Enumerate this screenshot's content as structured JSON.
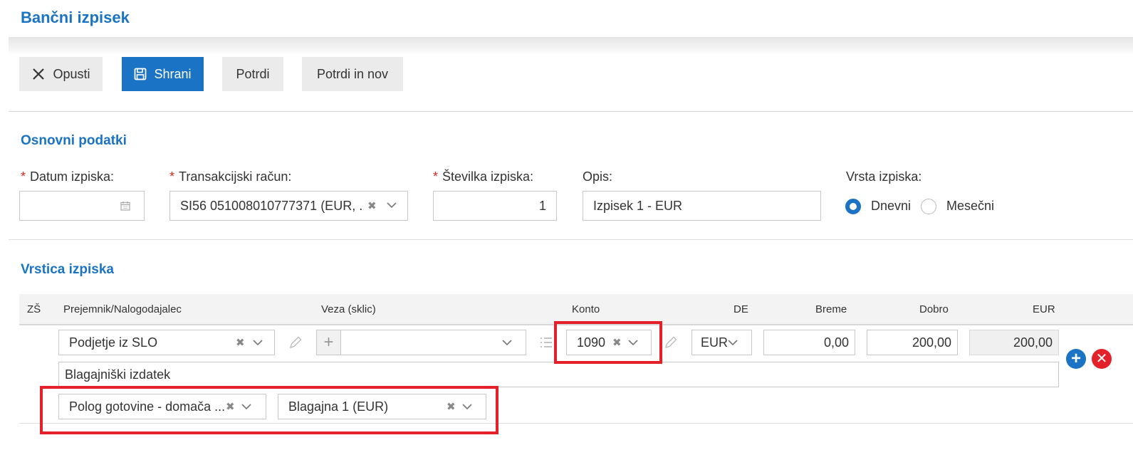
{
  "page": {
    "title": "Bančni izpisek"
  },
  "toolbar": {
    "cancel_label": "Opusti",
    "save_label": "Shrani",
    "confirm_label": "Potrdi",
    "confirm_new_label": "Potrdi in nov"
  },
  "basic": {
    "section_title": "Osnovni podatki",
    "date_label": "Datum izpiska:",
    "date_value": "",
    "account_label": "Transakcijski račun:",
    "account_value": "SI56 051008010777371 (EUR, ...",
    "number_label": "Številka izpiska:",
    "number_value": "1",
    "desc_label": "Opis:",
    "desc_value": "Izpisek 1 - EUR",
    "type_label": "Vrsta izpiska:",
    "type_options": [
      "Dnevni",
      "Mesečni"
    ],
    "type_selected": "Dnevni",
    "required_mark": "*"
  },
  "lines": {
    "section_title": "Vrstica izpiska",
    "columns": [
      "ZŠ",
      "Prejemnik/Nalogodajalec",
      "Veza (sklic)",
      "Konto",
      "DE",
      "Breme",
      "Dobro",
      "EUR"
    ],
    "row": {
      "recipient": "Podjetje iz SLO",
      "reference": "",
      "account": "1090",
      "currency": "EUR",
      "debit": "0,00",
      "credit": "200,00",
      "eur": "200,00",
      "description": "Blagajniški izdatek",
      "type": "Polog gotovine - domača ...",
      "cashbox": "Blagajna 1 (EUR)"
    }
  },
  "colors": {
    "accent": "#1a73c4",
    "danger": "#e4202a",
    "highlight": "#e4202a"
  }
}
